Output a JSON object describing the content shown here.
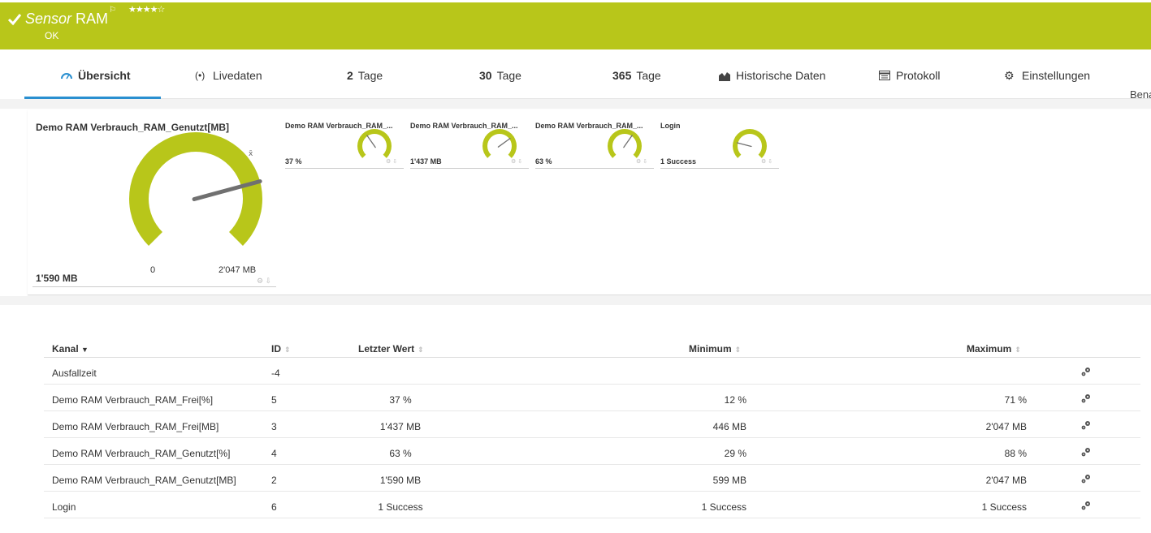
{
  "header": {
    "title_italic": "Sensor",
    "title_rest": " RAM",
    "stars": "★★★★☆",
    "status": "OK"
  },
  "tabs": [
    {
      "label": "Übersicht"
    },
    {
      "label": "Livedaten"
    },
    {
      "num": "2",
      "label": "Tage"
    },
    {
      "num": "30",
      "label": "Tage"
    },
    {
      "num": "365",
      "label": "Tage"
    },
    {
      "label": "Historische Daten"
    },
    {
      "label": "Protokoll"
    },
    {
      "label": "Einstellungen"
    }
  ],
  "cut_off_text": "Bena",
  "big_gauge": {
    "title": "Demo RAM Verbrauch_RAM_Genutzt[MB]",
    "value": "1'590 MB",
    "min": "0",
    "max": "2'047 MB",
    "fraction": 0.777,
    "avg_marker": "x̄"
  },
  "mini_gauges": [
    {
      "title": "Demo RAM Verbrauch_RAM_...",
      "value": "37 %",
      "fraction": 0.37
    },
    {
      "title": "Demo RAM Verbrauch_RAM_...",
      "value": "1'437 MB",
      "fraction": 0.7
    },
    {
      "title": "Demo RAM Verbrauch_RAM_...",
      "value": "63 %",
      "fraction": 0.63
    },
    {
      "title": "Login",
      "value": "1 Success",
      "fraction": 0.22
    }
  ],
  "colors": {
    "brand": "#b8c61a",
    "active_tab": "#2a8fd0",
    "needle": "#707070"
  },
  "table": {
    "headers": {
      "name": "Kanal",
      "id": "ID",
      "last": "Letzter Wert",
      "min": "Minimum",
      "max": "Maximum"
    },
    "rows": [
      {
        "name": "Ausfallzeit",
        "id": "-4",
        "last": "",
        "min": "",
        "max": ""
      },
      {
        "name": "Demo RAM Verbrauch_RAM_Frei[%]",
        "id": "5",
        "last": "37 %",
        "min": "12 %",
        "max": "71 %"
      },
      {
        "name": "Demo RAM Verbrauch_RAM_Frei[MB]",
        "id": "3",
        "last": "1'437 MB",
        "min": "446 MB",
        "max": "2'047 MB"
      },
      {
        "name": "Demo RAM Verbrauch_RAM_Genutzt[%]",
        "id": "4",
        "last": "63 %",
        "min": "29 %",
        "max": "88 %"
      },
      {
        "name": "Demo RAM Verbrauch_RAM_Genutzt[MB]",
        "id": "2",
        "last": "1'590 MB",
        "min": "599 MB",
        "max": "2'047 MB"
      },
      {
        "name": "Login",
        "id": "6",
        "last": "1 Success",
        "min": "1 Success",
        "max": "1 Success"
      }
    ]
  }
}
